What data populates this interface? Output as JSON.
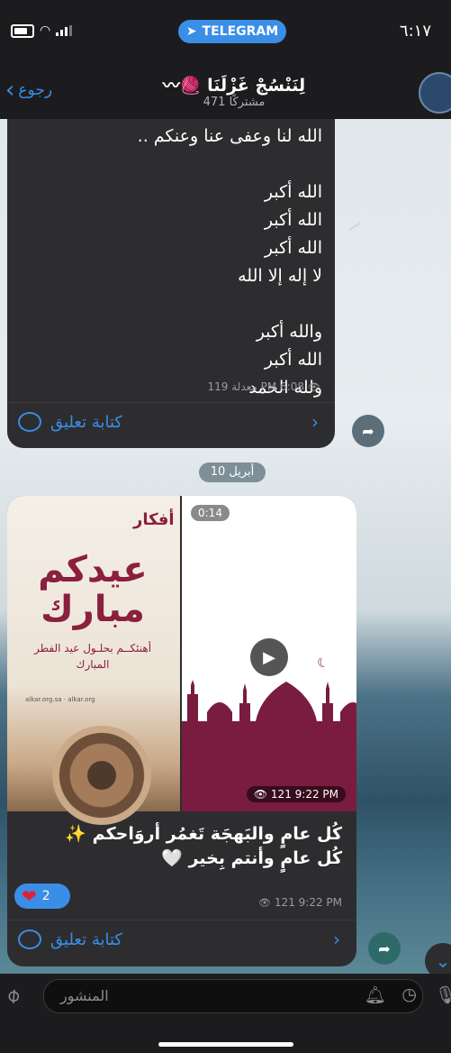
{
  "status": {
    "time": "٦:١٧",
    "app_pill": "TELEGRAM"
  },
  "header": {
    "back_label": "رجوع",
    "channel_title": "لِنَنْسُجْ غَزْلَنَا 🧶〰",
    "subscribers": "471 مشتركًا"
  },
  "message1": {
    "lines": [
      "الله لنا وعفى عنا وعنكم ..",
      "",
      "الله أكبر",
      "الله أكبر",
      "الله أكبر",
      "لا إله إلا الله",
      "",
      "والله أكبر",
      "الله أكبر",
      "ولله الحمد"
    ],
    "meta": "119 معدلة PM 6:08",
    "comment_label": "كتابة تعليق"
  },
  "date_separator": "10 أبريل",
  "message2": {
    "card": {
      "logo": "أفكار",
      "title": "عيدكم مبارك",
      "subtitle": "أهنئكــم بحلـول عيد الفطر المبارك",
      "footer": "alkar.org.sa · alkar.org"
    },
    "video": {
      "duration": "0:14",
      "meta": "121 9:22 PM"
    },
    "caption_line1": "كُل عامٍ والبَهجَة تَغمُر أروَاحكم ✨",
    "caption_line2": "كُل عامٍ وأنتم بِخير 🤍",
    "reaction_count": "2",
    "meta": "121 9:22 PM",
    "comment_label": "كتابة تعليق"
  },
  "input": {
    "placeholder": "المنشور"
  }
}
